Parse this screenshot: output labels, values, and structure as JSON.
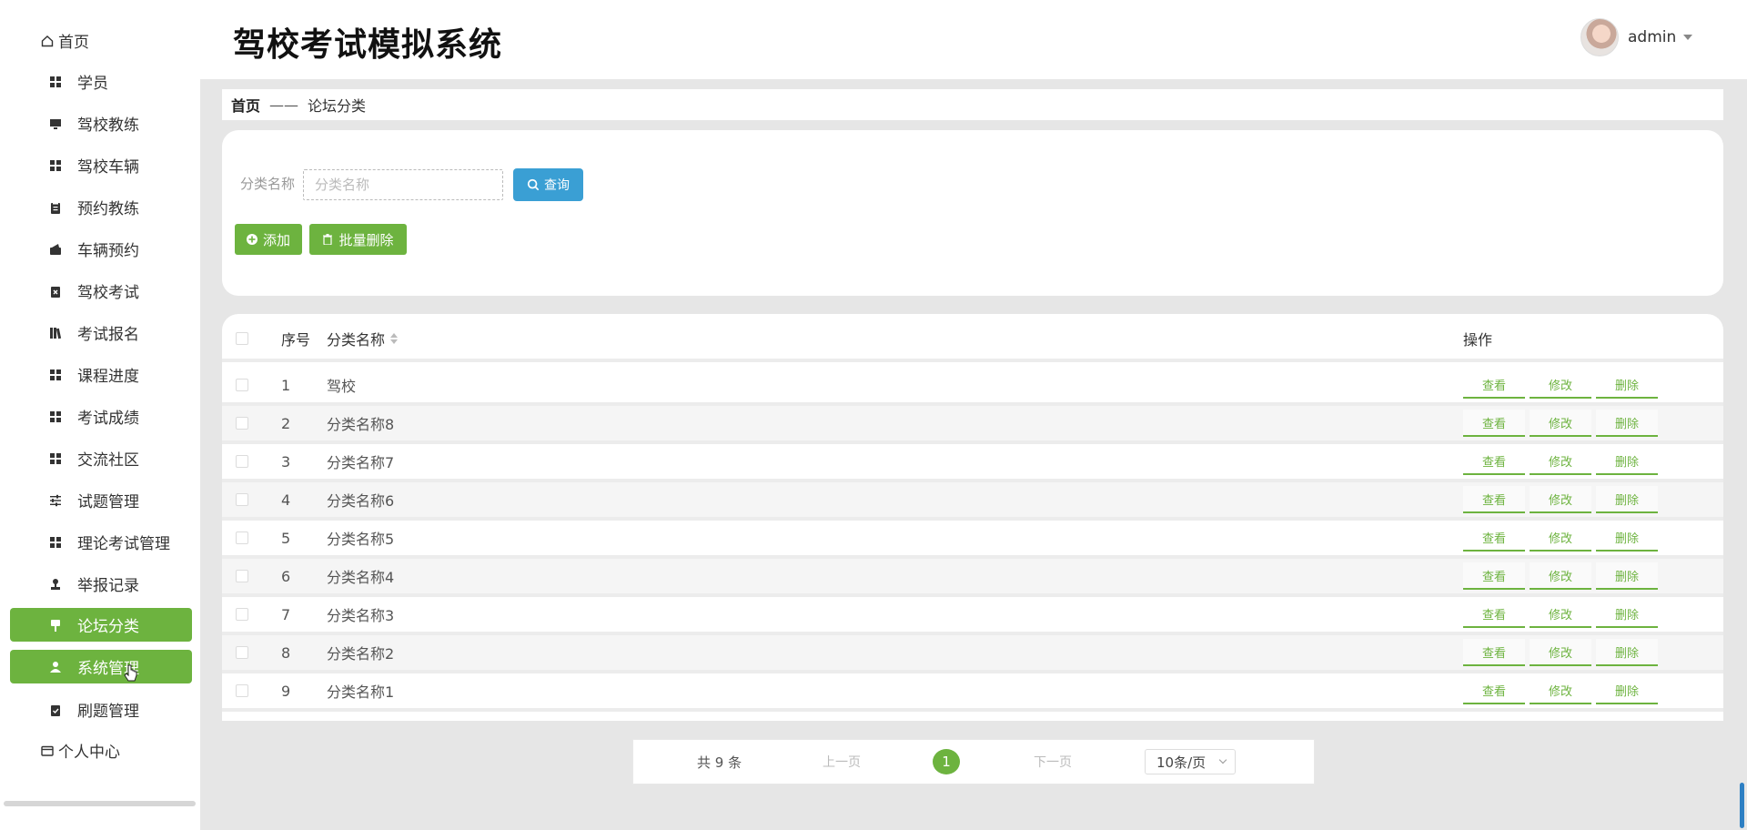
{
  "header": {
    "title": "驾校考试模拟系统",
    "username": "admin"
  },
  "sidebar": {
    "items": [
      {
        "label": "首页",
        "icon": "home-icon"
      },
      {
        "label": "学员",
        "icon": "grid-icon"
      },
      {
        "label": "驾校教练",
        "icon": "monitor-icon"
      },
      {
        "label": "驾校车辆",
        "icon": "grid-icon"
      },
      {
        "label": "预约教练",
        "icon": "clipboard-icon"
      },
      {
        "label": "车辆预约",
        "icon": "wallet-icon"
      },
      {
        "label": "驾校考试",
        "icon": "clipboard-x-icon"
      },
      {
        "label": "考试报名",
        "icon": "books-icon"
      },
      {
        "label": "课程进度",
        "icon": "grid-icon"
      },
      {
        "label": "考试成绩",
        "icon": "grid-icon"
      },
      {
        "label": "交流社区",
        "icon": "grid-icon"
      },
      {
        "label": "试题管理",
        "icon": "sliders-icon"
      },
      {
        "label": "理论考试管理",
        "icon": "grid-icon"
      },
      {
        "label": "举报记录",
        "icon": "stamp-icon"
      },
      {
        "label": "论坛分类",
        "icon": "sign-icon",
        "active": true
      },
      {
        "label": "系统管理",
        "icon": "user-icon",
        "active": true
      },
      {
        "label": "刷题管理",
        "icon": "clipboard-check-icon"
      },
      {
        "label": "个人中心",
        "icon": "card-icon"
      }
    ]
  },
  "breadcrumb": {
    "home": "首页",
    "separator": "——",
    "current": "论坛分类"
  },
  "search": {
    "label": "分类名称",
    "placeholder": "分类名称",
    "value": "",
    "query_button": "查询",
    "add_button": "添加",
    "batch_delete_button": "批量删除"
  },
  "table": {
    "columns": {
      "index": "序号",
      "name": "分类名称",
      "actions": "操作"
    },
    "action_labels": {
      "view": "查看",
      "edit": "修改",
      "delete": "删除"
    },
    "rows": [
      {
        "index": "1",
        "name": "驾校"
      },
      {
        "index": "2",
        "name": "分类名称8"
      },
      {
        "index": "3",
        "name": "分类名称7"
      },
      {
        "index": "4",
        "name": "分类名称6"
      },
      {
        "index": "5",
        "name": "分类名称5"
      },
      {
        "index": "6",
        "name": "分类名称4"
      },
      {
        "index": "7",
        "name": "分类名称3"
      },
      {
        "index": "8",
        "name": "分类名称2"
      },
      {
        "index": "9",
        "name": "分类名称1"
      }
    ]
  },
  "pagination": {
    "total": "共 9 条",
    "prev": "上一页",
    "current_page": "1",
    "next": "下一页",
    "page_size": "10条/页"
  },
  "colors": {
    "accent_green": "#6db33f",
    "query_blue": "#3a9fd4"
  }
}
